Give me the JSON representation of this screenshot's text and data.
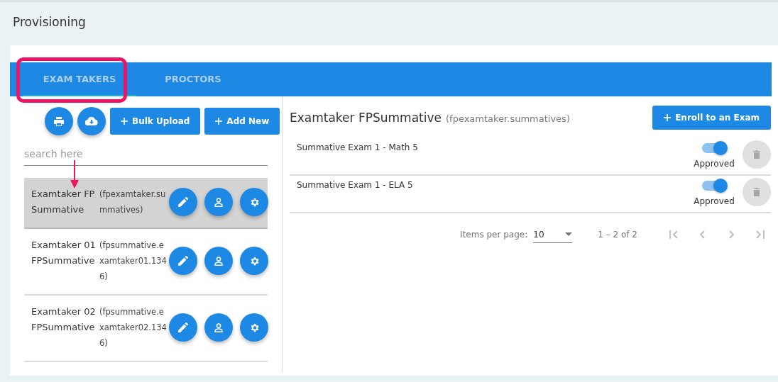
{
  "page_title": "Provisioning",
  "tabs": [
    {
      "label": "EXAM TAKERS",
      "selected": true
    },
    {
      "label": "PROCTORS",
      "selected": false
    }
  ],
  "toolbar": {
    "bulk_upload": "Bulk Upload",
    "add_new": "Add New"
  },
  "search": {
    "placeholder": "search here"
  },
  "exam_takers": [
    {
      "name": "Examtaker FPSummative",
      "username": "(fpexamtaker.summatives)",
      "selected": true
    },
    {
      "name": "Examtaker 01 FPSummative",
      "username": "(fpsummative.examtaker01.1346)",
      "selected": false
    },
    {
      "name": "Examtaker 02 FPSummative",
      "username": "(fpsummative.examtaker02.1346)",
      "selected": false
    }
  ],
  "detail": {
    "name": "Examtaker FPSummative",
    "username": "(fpexamtaker.summatives)",
    "enroll_button": "Enroll to an Exam",
    "exams": [
      {
        "title": "Summative Exam 1 - Math 5",
        "approved": true,
        "status": "Approved",
        "delete_disabled": true
      },
      {
        "title": "Summative Exam 1 - ELA 5",
        "approved": true,
        "status": "Approved",
        "delete_disabled": true
      }
    ],
    "pagination": {
      "items_per_page_label": "Items per page:",
      "page_size": "10",
      "range": "1 – 2 of 2",
      "buttons": [
        {
          "kind": "first",
          "disabled": true
        },
        {
          "kind": "prev",
          "disabled": true
        },
        {
          "kind": "next",
          "disabled": true
        },
        {
          "kind": "last",
          "disabled": true
        }
      ]
    }
  }
}
